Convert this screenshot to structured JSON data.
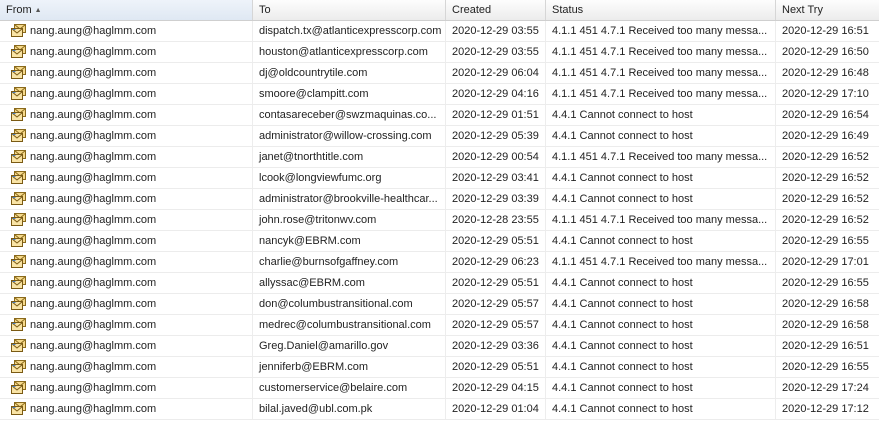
{
  "columns": [
    {
      "label": "From",
      "sorted": true
    },
    {
      "label": "To"
    },
    {
      "label": "Created"
    },
    {
      "label": "Status"
    },
    {
      "label": "Next Try"
    }
  ],
  "icons": {
    "row_icon": "queued-message-icon"
  },
  "rows": [
    {
      "from": "nang.aung@haglmm.com",
      "to": "dispatch.tx@atlanticexpresscorp.com",
      "created": "2020-12-29 03:55",
      "status": "4.1.1 451 4.7.1 Received too many messa...",
      "next_try": "2020-12-29 16:51"
    },
    {
      "from": "nang.aung@haglmm.com",
      "to": "houston@atlanticexpresscorp.com",
      "created": "2020-12-29 03:55",
      "status": "4.1.1 451 4.7.1 Received too many messa...",
      "next_try": "2020-12-29 16:50"
    },
    {
      "from": "nang.aung@haglmm.com",
      "to": "dj@oldcountrytile.com",
      "created": "2020-12-29 06:04",
      "status": "4.1.1 451 4.7.1 Received too many messa...",
      "next_try": "2020-12-29 16:48"
    },
    {
      "from": "nang.aung@haglmm.com",
      "to": "smoore@clampitt.com",
      "created": "2020-12-29 04:16",
      "status": "4.1.1 451 4.7.1 Received too many messa...",
      "next_try": "2020-12-29 17:10"
    },
    {
      "from": "nang.aung@haglmm.com",
      "to": "contasareceber@swzmaquinas.co...",
      "created": "2020-12-29 01:51",
      "status": "4.4.1 Cannot connect to host",
      "next_try": "2020-12-29 16:54"
    },
    {
      "from": "nang.aung@haglmm.com",
      "to": "administrator@willow-crossing.com",
      "created": "2020-12-29 05:39",
      "status": "4.4.1 Cannot connect to host",
      "next_try": "2020-12-29 16:49"
    },
    {
      "from": "nang.aung@haglmm.com",
      "to": "janet@tnorthtitle.com",
      "created": "2020-12-29 00:54",
      "status": "4.1.1 451 4.7.1 Received too many messa...",
      "next_try": "2020-12-29 16:52"
    },
    {
      "from": "nang.aung@haglmm.com",
      "to": "lcook@longviewfumc.org",
      "created": "2020-12-29 03:41",
      "status": "4.4.1 Cannot connect to host",
      "next_try": "2020-12-29 16:52"
    },
    {
      "from": "nang.aung@haglmm.com",
      "to": "administrator@brookville-healthcar...",
      "created": "2020-12-29 03:39",
      "status": "4.4.1 Cannot connect to host",
      "next_try": "2020-12-29 16:52"
    },
    {
      "from": "nang.aung@haglmm.com",
      "to": "john.rose@tritonwv.com",
      "created": "2020-12-28 23:55",
      "status": "4.1.1 451 4.7.1 Received too many messa...",
      "next_try": "2020-12-29 16:52"
    },
    {
      "from": "nang.aung@haglmm.com",
      "to": "nancyk@EBRM.com",
      "created": "2020-12-29 05:51",
      "status": "4.4.1 Cannot connect to host",
      "next_try": "2020-12-29 16:55"
    },
    {
      "from": "nang.aung@haglmm.com",
      "to": "charlie@burnsofgaffney.com",
      "created": "2020-12-29 06:23",
      "status": "4.1.1 451 4.7.1 Received too many messa...",
      "next_try": "2020-12-29 17:01"
    },
    {
      "from": "nang.aung@haglmm.com",
      "to": "allyssac@EBRM.com",
      "created": "2020-12-29 05:51",
      "status": "4.4.1 Cannot connect to host",
      "next_try": "2020-12-29 16:55"
    },
    {
      "from": "nang.aung@haglmm.com",
      "to": "don@columbustransitional.com",
      "created": "2020-12-29 05:57",
      "status": "4.4.1 Cannot connect to host",
      "next_try": "2020-12-29 16:58"
    },
    {
      "from": "nang.aung@haglmm.com",
      "to": "medrec@columbustransitional.com",
      "created": "2020-12-29 05:57",
      "status": "4.4.1 Cannot connect to host",
      "next_try": "2020-12-29 16:58"
    },
    {
      "from": "nang.aung@haglmm.com",
      "to": "Greg.Daniel@amarillo.gov",
      "created": "2020-12-29 03:36",
      "status": "4.4.1 Cannot connect to host",
      "next_try": "2020-12-29 16:51"
    },
    {
      "from": "nang.aung@haglmm.com",
      "to": "jenniferb@EBRM.com",
      "created": "2020-12-29 05:51",
      "status": "4.4.1 Cannot connect to host",
      "next_try": "2020-12-29 16:55"
    },
    {
      "from": "nang.aung@haglmm.com",
      "to": "customerservice@belaire.com",
      "created": "2020-12-29 04:15",
      "status": "4.4.1 Cannot connect to host",
      "next_try": "2020-12-29 17:24"
    },
    {
      "from": "nang.aung@haglmm.com",
      "to": "bilal.javed@ubl.com.pk",
      "created": "2020-12-29 01:04",
      "status": "4.4.1 Cannot connect to host",
      "next_try": "2020-12-29 17:12"
    }
  ]
}
